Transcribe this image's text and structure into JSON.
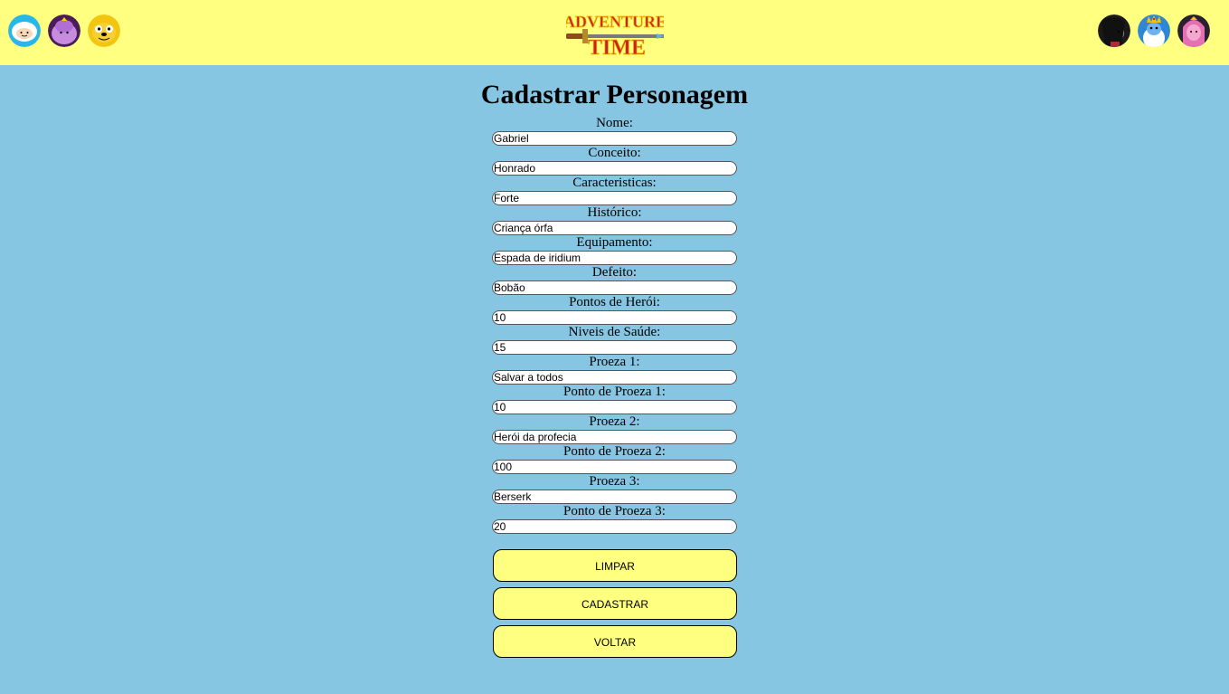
{
  "header": {
    "logo_line1": "ADVENTURE",
    "logo_line2": "TIME",
    "left_avatars": [
      "finn-avatar",
      "lumpy-space-princess-avatar",
      "jake-avatar"
    ],
    "right_avatars": [
      "marceline-avatar",
      "ice-king-avatar",
      "princess-bubblegum-avatar"
    ]
  },
  "page": {
    "title": "Cadastrar Personagem"
  },
  "form": {
    "fields": [
      {
        "label": "Nome:",
        "value": "Gabriel"
      },
      {
        "label": "Conceito:",
        "value": "Honrado"
      },
      {
        "label": "Caracteristicas:",
        "value": "Forte"
      },
      {
        "label": "Histórico:",
        "value": "Criança órfa"
      },
      {
        "label": "Equipamento:",
        "value": "Espada de iridium"
      },
      {
        "label": "Defeito:",
        "value": "Bobão"
      },
      {
        "label": "Pontos de Herói:",
        "value": "10"
      },
      {
        "label": "Niveis de Saúde:",
        "value": "15"
      },
      {
        "label": "Proeza 1:",
        "value": "Salvar a todos"
      },
      {
        "label": "Ponto de Proeza 1:",
        "value": "10"
      },
      {
        "label": "Proeza 2:",
        "value": "Herói da profecia"
      },
      {
        "label": "Ponto de Proeza 2:",
        "value": "100"
      },
      {
        "label": "Proeza 3:",
        "value": "Berserk"
      },
      {
        "label": "Ponto de Proeza 3:",
        "value": "20"
      }
    ]
  },
  "buttons": {
    "clear": "LIMPAR",
    "submit": "CADASTRAR",
    "back": "VOLTAR"
  },
  "colors": {
    "header_bg": "#ffff80",
    "page_bg": "#87c6e3",
    "button_bg": "#ffff80"
  }
}
